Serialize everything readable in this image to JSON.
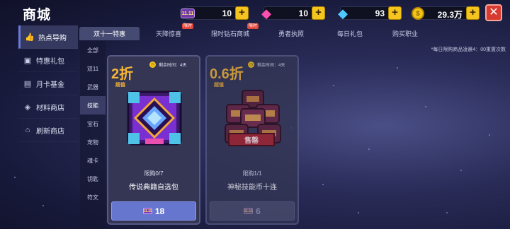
{
  "header": {
    "title": "商城",
    "currencies": [
      {
        "name": "ticket",
        "icon": "ticket-icon",
        "value": "10",
        "badge_text": "11.11"
      },
      {
        "name": "pink-gem",
        "icon": "pink-gem-icon",
        "value": "10"
      },
      {
        "name": "blue-gem",
        "icon": "blue-gem-icon",
        "value": "93"
      },
      {
        "name": "gold-coin",
        "icon": "gold-coin-icon",
        "value": "29.3万"
      }
    ],
    "plus_label": "+",
    "close_label": "✕"
  },
  "sidebar": {
    "items": [
      {
        "label": "热点导购",
        "icon": "thumbs-up-icon",
        "active": true
      },
      {
        "label": "特惠礼包",
        "icon": "gift-icon"
      },
      {
        "label": "月卡基金",
        "icon": "card-icon"
      },
      {
        "label": "材料商店",
        "icon": "materials-icon"
      },
      {
        "label": "刷新商店",
        "icon": "refresh-icon"
      }
    ]
  },
  "tabs": [
    {
      "label": "双十一特惠",
      "active": true
    },
    {
      "label": "天降惊喜",
      "badge": "限时"
    },
    {
      "label": "限时钻石商城",
      "badge": "限时"
    },
    {
      "label": "勇者执照"
    },
    {
      "label": "每日礼包"
    },
    {
      "label": "购买职业"
    }
  ],
  "notice": "*每日限购商品凌晨4：00重置次数",
  "subnav": [
    "全部",
    "双11",
    "武器",
    "技能",
    "宝石",
    "宠物",
    "魂卡",
    "钥匙",
    "符文"
  ],
  "subnav_active": "技能",
  "cards": [
    {
      "discount": "2折",
      "super_label": "超值",
      "timer_label": "剩余时间：4天",
      "limit": "限购0/7",
      "name": "传说典籍自选包",
      "price": "18",
      "currency_badge": "11.11",
      "sold_out": false
    },
    {
      "discount": "0.6折",
      "super_label": "超值",
      "timer_label": "剩余时间：4天",
      "limit": "限购1/1",
      "name": "神秘技能币十连",
      "price": "6",
      "currency_badge": "11.11",
      "sold_out": true,
      "sold_out_label": "售罄"
    }
  ],
  "colors": {
    "accent_gold": "#f7b736",
    "buy_button": "#6676cf",
    "close_red": "#d93a2f"
  }
}
